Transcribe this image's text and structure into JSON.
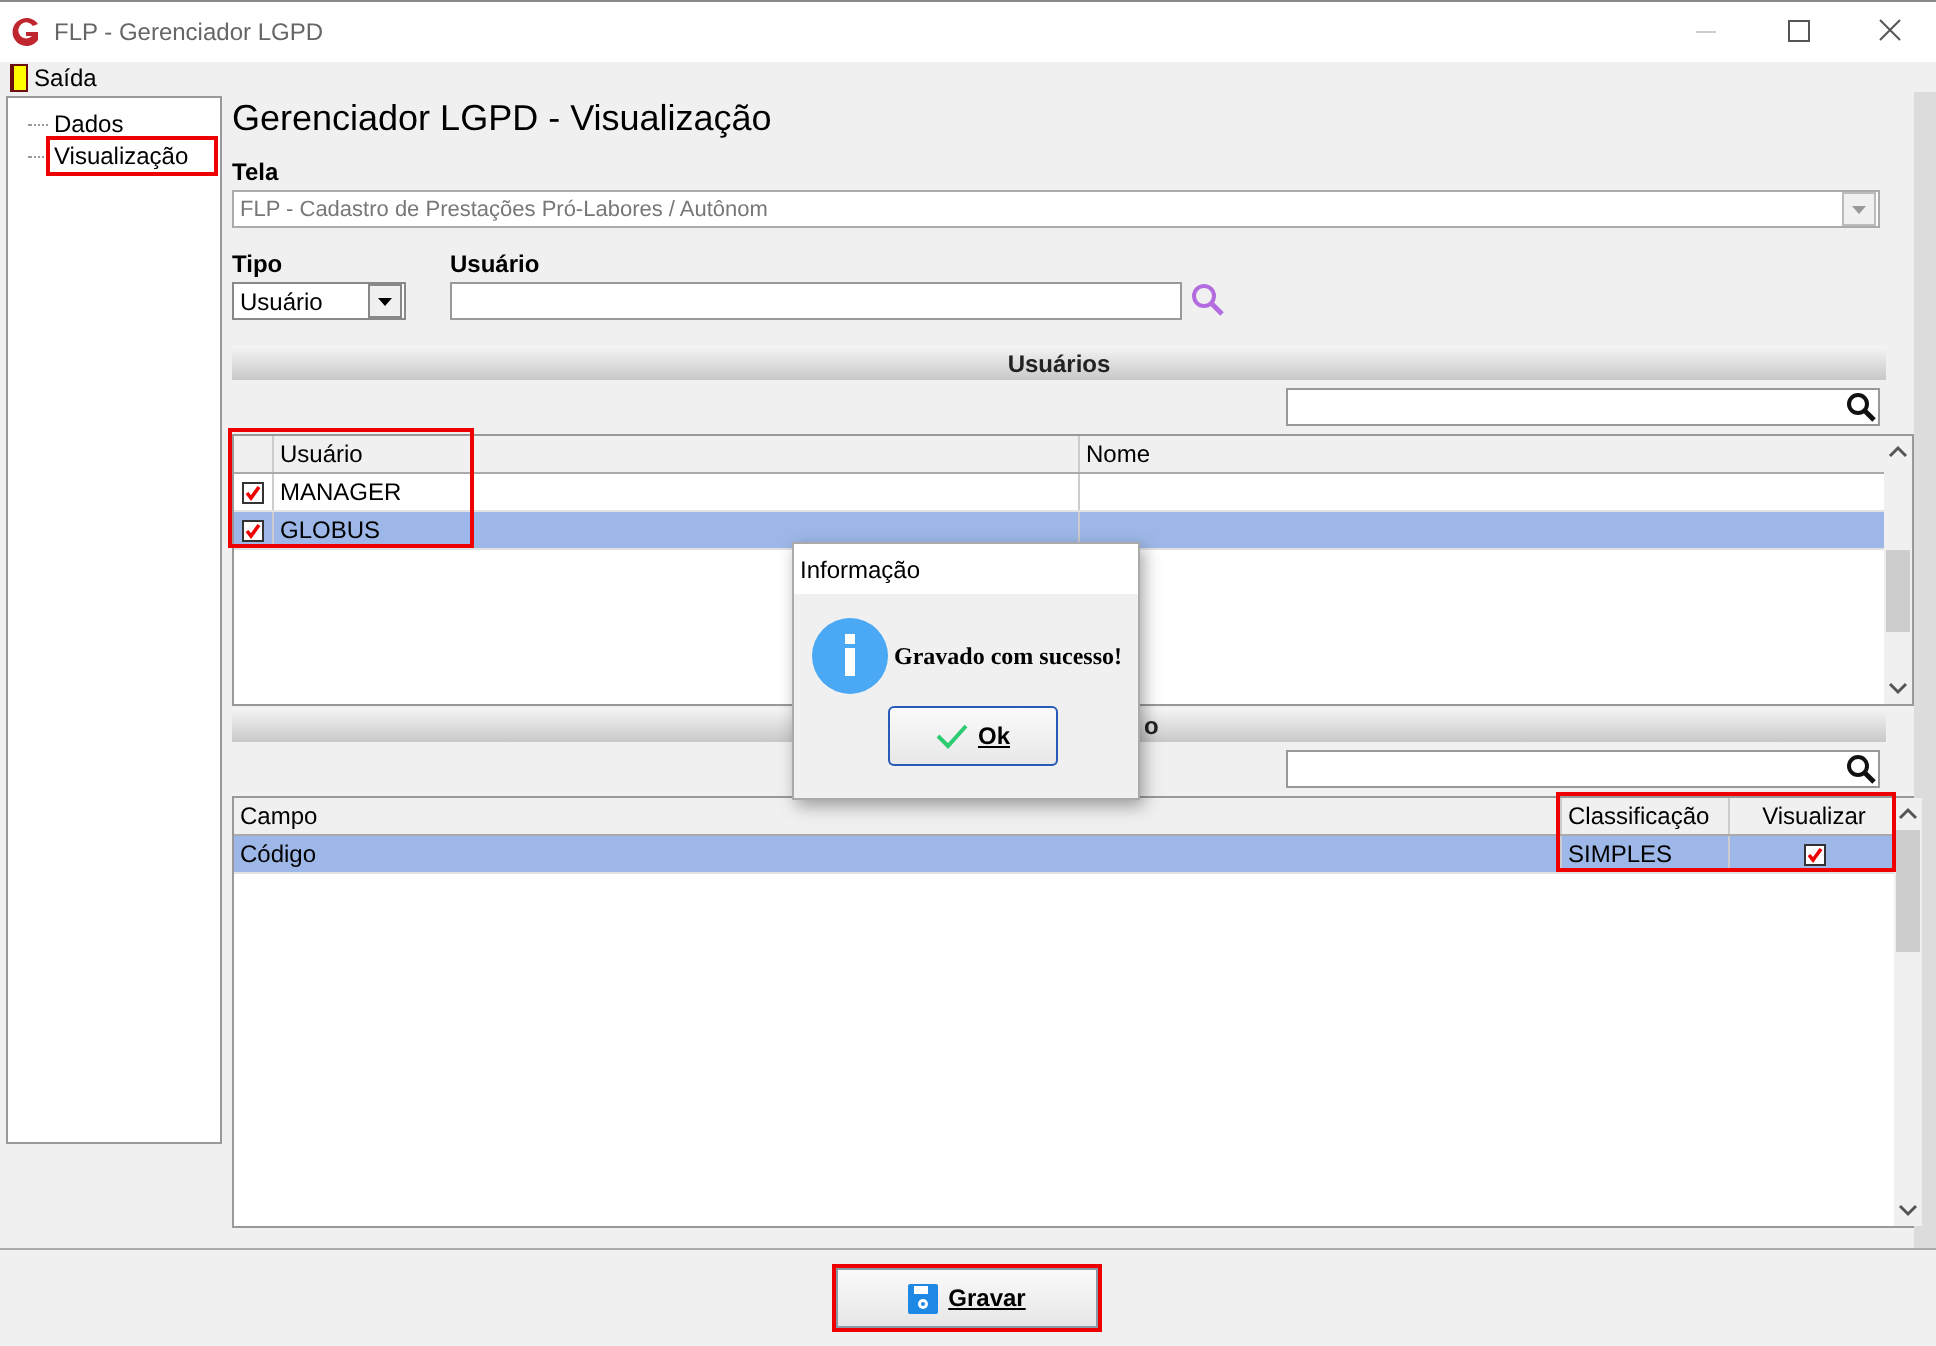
{
  "window": {
    "title": "FLP - Gerenciador LGPD"
  },
  "menu": [
    {
      "label": "Saída"
    }
  ],
  "sidebar": {
    "items": [
      {
        "label": "Dados",
        "highlighted": false
      },
      {
        "label": "Visualização",
        "highlighted": true
      }
    ]
  },
  "heading": "Gerenciador LGPD - Visualização",
  "tela": {
    "label": "Tela",
    "value": "FLP - Cadastro de Prestações Pró-Labores / Autônom"
  },
  "tipo": {
    "label": "Tipo",
    "value": "Usuário"
  },
  "usuario": {
    "label": "Usuário"
  },
  "users_section": {
    "title": "Usuários"
  },
  "users_table": {
    "highlighted": true,
    "columns": [
      "Usuário",
      "Nome"
    ],
    "rows": [
      {
        "checked": true,
        "selected": false,
        "cells": [
          "MANAGER"
        ]
      },
      {
        "checked": true,
        "selected": true,
        "cells": [
          "GLOBUS"
        ]
      }
    ]
  },
  "fields_section": {
    "title": "o"
  },
  "fields_table": {
    "columns": [
      {
        "label": "Campo",
        "highlighted": false
      },
      {
        "label": "Classificação",
        "highlighted": true
      },
      {
        "label": "Visualizar",
        "highlighted": true
      }
    ],
    "rows": [
      {
        "selected": true,
        "visualizar": true,
        "cells": [
          "Código",
          "SIMPLES"
        ]
      }
    ]
  },
  "save_button": {
    "label": "Gravar",
    "highlighted": true
  },
  "dialog": {
    "title": "Informação",
    "message": "Gravado com sucesso!",
    "button": "Ok"
  }
}
